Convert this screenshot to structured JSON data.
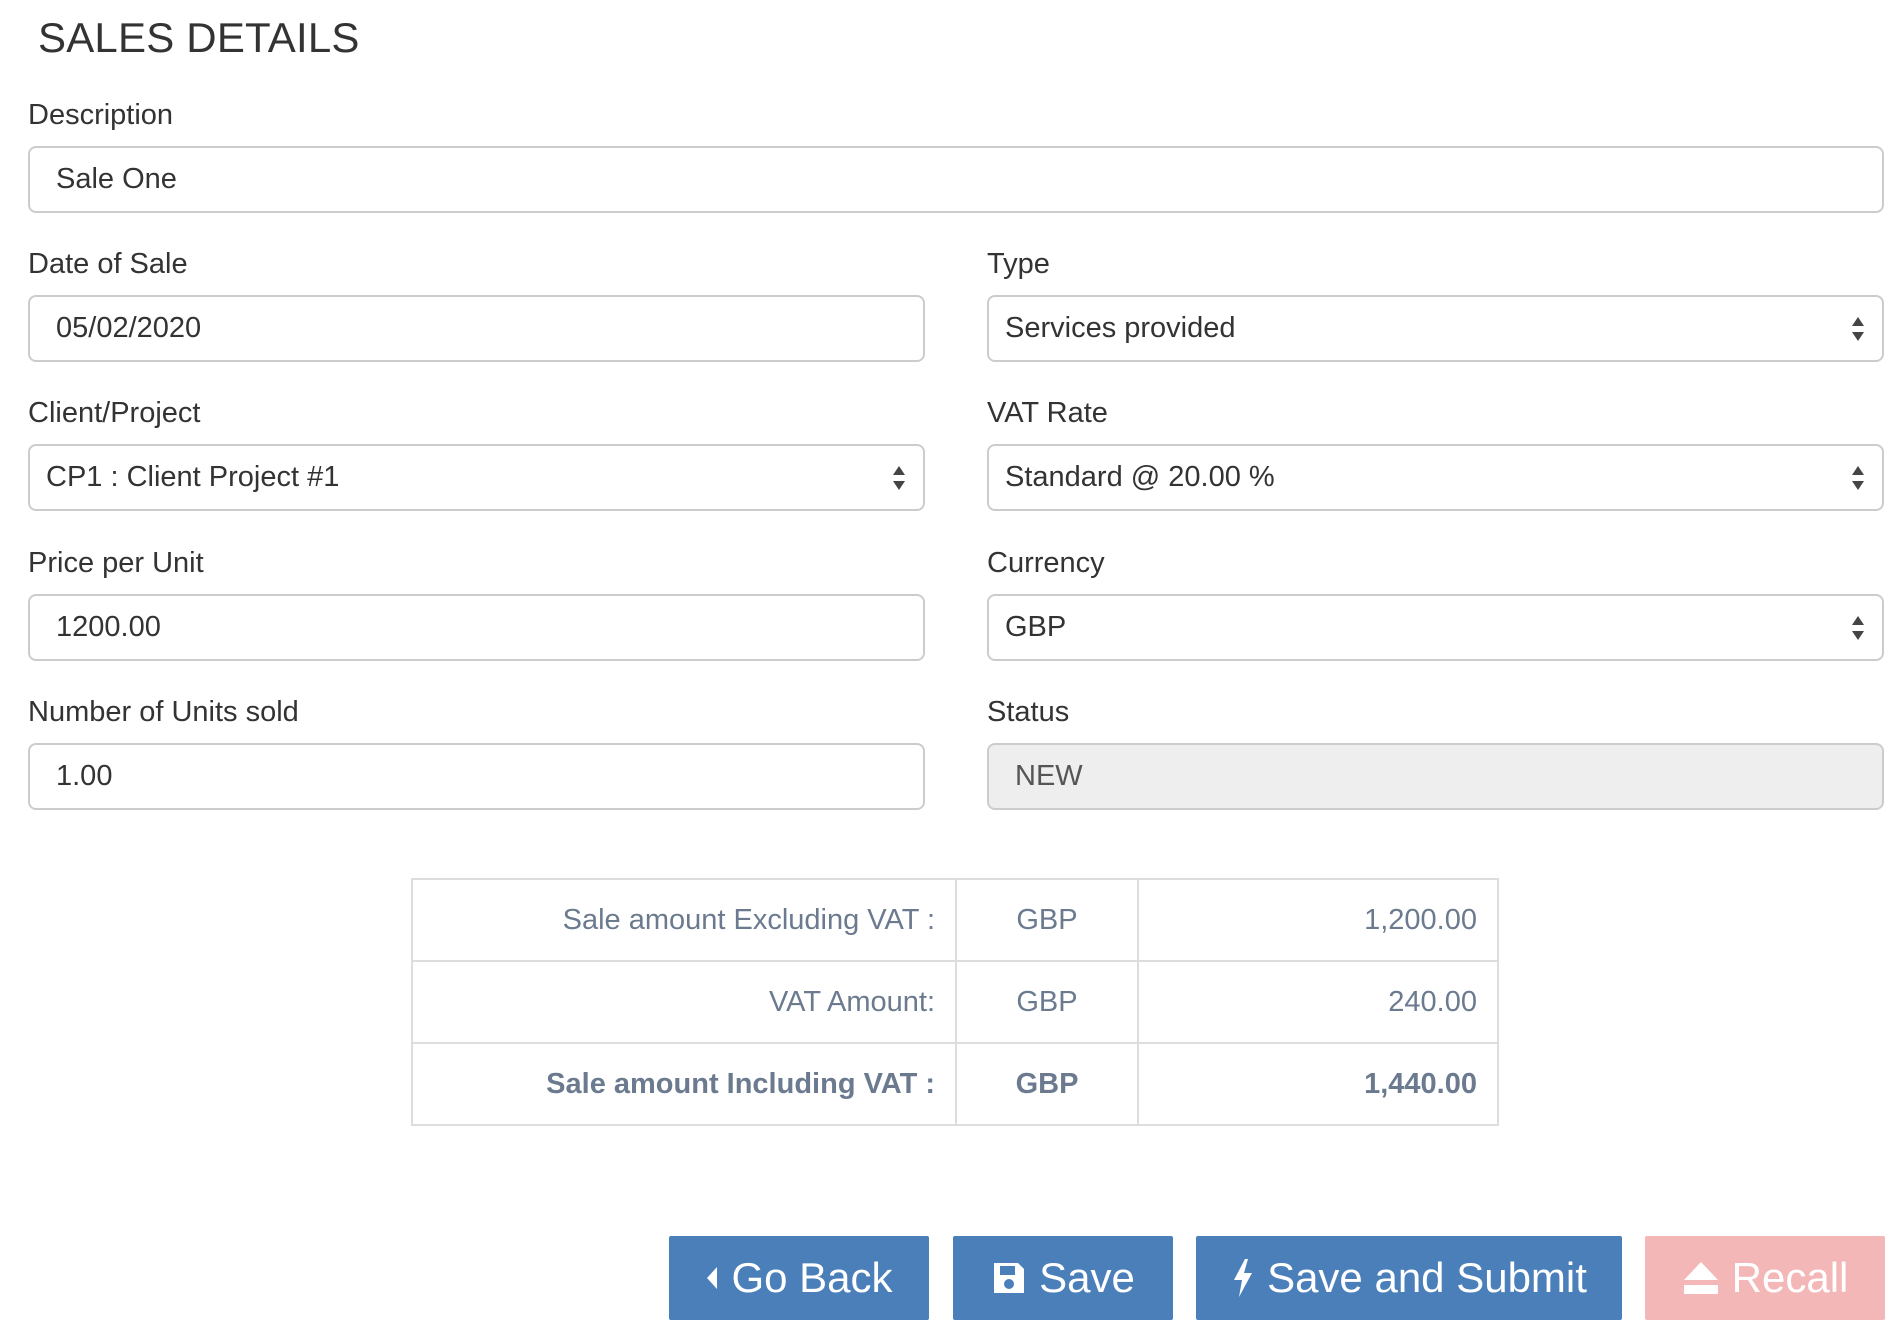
{
  "page": {
    "title": "SALES DETAILS"
  },
  "form": {
    "description": {
      "label": "Description",
      "value": "Sale One"
    },
    "date_of_sale": {
      "label": "Date of Sale",
      "value": "05/02/2020"
    },
    "type": {
      "label": "Type",
      "selected": "Services provided"
    },
    "client_project": {
      "label": "Client/Project",
      "selected": "CP1 : Client Project #1"
    },
    "vat_rate": {
      "label": "VAT Rate",
      "selected": "Standard @ 20.00 %"
    },
    "price_per_unit": {
      "label": "Price per Unit",
      "value": "1200.00"
    },
    "currency": {
      "label": "Currency",
      "selected": "GBP"
    },
    "units_sold": {
      "label": "Number of Units sold",
      "value": "1.00"
    },
    "status": {
      "label": "Status",
      "value": "NEW"
    }
  },
  "summary": {
    "rows": [
      {
        "label": "Sale amount Excluding VAT :",
        "currency": "GBP",
        "amount": "1,200.00"
      },
      {
        "label": "VAT Amount:",
        "currency": "GBP",
        "amount": "240.00"
      },
      {
        "label": "Sale amount Including VAT :",
        "currency": "GBP",
        "amount": "1,440.00"
      }
    ]
  },
  "buttons": {
    "go_back": {
      "label": "Go Back",
      "icon": "caret-left-icon"
    },
    "save": {
      "label": "Save",
      "icon": "floppy-disk-icon"
    },
    "save_submit": {
      "label": "Save and Submit",
      "icon": "lightning-bolt-icon"
    },
    "recall": {
      "label": "Recall",
      "icon": "eject-icon"
    }
  },
  "colors": {
    "primary_button": "#4a7fba",
    "recall_button": "#f4b7b7",
    "summary_text": "#6b7a8f",
    "readonly_bg": "#eeeeee"
  }
}
